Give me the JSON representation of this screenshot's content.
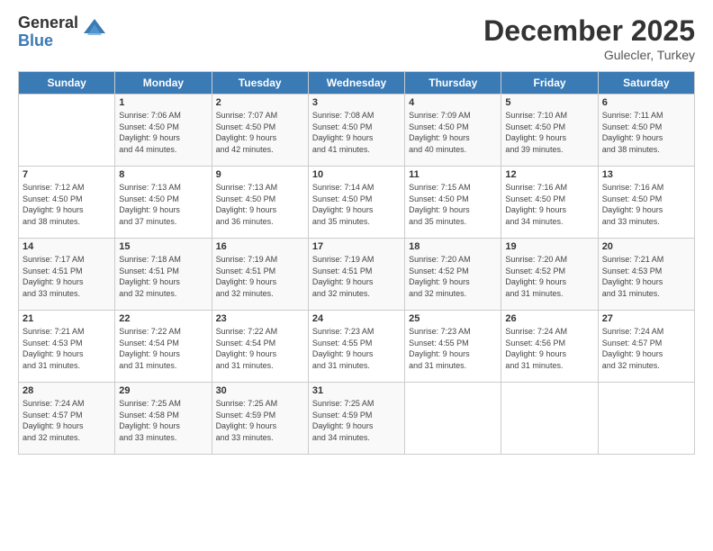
{
  "logo": {
    "general": "General",
    "blue": "Blue"
  },
  "title": "December 2025",
  "subtitle": "Gulecler, Turkey",
  "days_header": [
    "Sunday",
    "Monday",
    "Tuesday",
    "Wednesday",
    "Thursday",
    "Friday",
    "Saturday"
  ],
  "weeks": [
    [
      {
        "day": "",
        "info": ""
      },
      {
        "day": "1",
        "info": "Sunrise: 7:06 AM\nSunset: 4:50 PM\nDaylight: 9 hours\nand 44 minutes."
      },
      {
        "day": "2",
        "info": "Sunrise: 7:07 AM\nSunset: 4:50 PM\nDaylight: 9 hours\nand 42 minutes."
      },
      {
        "day": "3",
        "info": "Sunrise: 7:08 AM\nSunset: 4:50 PM\nDaylight: 9 hours\nand 41 minutes."
      },
      {
        "day": "4",
        "info": "Sunrise: 7:09 AM\nSunset: 4:50 PM\nDaylight: 9 hours\nand 40 minutes."
      },
      {
        "day": "5",
        "info": "Sunrise: 7:10 AM\nSunset: 4:50 PM\nDaylight: 9 hours\nand 39 minutes."
      },
      {
        "day": "6",
        "info": "Sunrise: 7:11 AM\nSunset: 4:50 PM\nDaylight: 9 hours\nand 38 minutes."
      }
    ],
    [
      {
        "day": "7",
        "info": "Sunrise: 7:12 AM\nSunset: 4:50 PM\nDaylight: 9 hours\nand 38 minutes."
      },
      {
        "day": "8",
        "info": "Sunrise: 7:13 AM\nSunset: 4:50 PM\nDaylight: 9 hours\nand 37 minutes."
      },
      {
        "day": "9",
        "info": "Sunrise: 7:13 AM\nSunset: 4:50 PM\nDaylight: 9 hours\nand 36 minutes."
      },
      {
        "day": "10",
        "info": "Sunrise: 7:14 AM\nSunset: 4:50 PM\nDaylight: 9 hours\nand 35 minutes."
      },
      {
        "day": "11",
        "info": "Sunrise: 7:15 AM\nSunset: 4:50 PM\nDaylight: 9 hours\nand 35 minutes."
      },
      {
        "day": "12",
        "info": "Sunrise: 7:16 AM\nSunset: 4:50 PM\nDaylight: 9 hours\nand 34 minutes."
      },
      {
        "day": "13",
        "info": "Sunrise: 7:16 AM\nSunset: 4:50 PM\nDaylight: 9 hours\nand 33 minutes."
      }
    ],
    [
      {
        "day": "14",
        "info": "Sunrise: 7:17 AM\nSunset: 4:51 PM\nDaylight: 9 hours\nand 33 minutes."
      },
      {
        "day": "15",
        "info": "Sunrise: 7:18 AM\nSunset: 4:51 PM\nDaylight: 9 hours\nand 32 minutes."
      },
      {
        "day": "16",
        "info": "Sunrise: 7:19 AM\nSunset: 4:51 PM\nDaylight: 9 hours\nand 32 minutes."
      },
      {
        "day": "17",
        "info": "Sunrise: 7:19 AM\nSunset: 4:51 PM\nDaylight: 9 hours\nand 32 minutes."
      },
      {
        "day": "18",
        "info": "Sunrise: 7:20 AM\nSunset: 4:52 PM\nDaylight: 9 hours\nand 32 minutes."
      },
      {
        "day": "19",
        "info": "Sunrise: 7:20 AM\nSunset: 4:52 PM\nDaylight: 9 hours\nand 31 minutes."
      },
      {
        "day": "20",
        "info": "Sunrise: 7:21 AM\nSunset: 4:53 PM\nDaylight: 9 hours\nand 31 minutes."
      }
    ],
    [
      {
        "day": "21",
        "info": "Sunrise: 7:21 AM\nSunset: 4:53 PM\nDaylight: 9 hours\nand 31 minutes."
      },
      {
        "day": "22",
        "info": "Sunrise: 7:22 AM\nSunset: 4:54 PM\nDaylight: 9 hours\nand 31 minutes."
      },
      {
        "day": "23",
        "info": "Sunrise: 7:22 AM\nSunset: 4:54 PM\nDaylight: 9 hours\nand 31 minutes."
      },
      {
        "day": "24",
        "info": "Sunrise: 7:23 AM\nSunset: 4:55 PM\nDaylight: 9 hours\nand 31 minutes."
      },
      {
        "day": "25",
        "info": "Sunrise: 7:23 AM\nSunset: 4:55 PM\nDaylight: 9 hours\nand 31 minutes."
      },
      {
        "day": "26",
        "info": "Sunrise: 7:24 AM\nSunset: 4:56 PM\nDaylight: 9 hours\nand 31 minutes."
      },
      {
        "day": "27",
        "info": "Sunrise: 7:24 AM\nSunset: 4:57 PM\nDaylight: 9 hours\nand 32 minutes."
      }
    ],
    [
      {
        "day": "28",
        "info": "Sunrise: 7:24 AM\nSunset: 4:57 PM\nDaylight: 9 hours\nand 32 minutes."
      },
      {
        "day": "29",
        "info": "Sunrise: 7:25 AM\nSunset: 4:58 PM\nDaylight: 9 hours\nand 33 minutes."
      },
      {
        "day": "30",
        "info": "Sunrise: 7:25 AM\nSunset: 4:59 PM\nDaylight: 9 hours\nand 33 minutes."
      },
      {
        "day": "31",
        "info": "Sunrise: 7:25 AM\nSunset: 4:59 PM\nDaylight: 9 hours\nand 34 minutes."
      },
      {
        "day": "",
        "info": ""
      },
      {
        "day": "",
        "info": ""
      },
      {
        "day": "",
        "info": ""
      }
    ]
  ]
}
